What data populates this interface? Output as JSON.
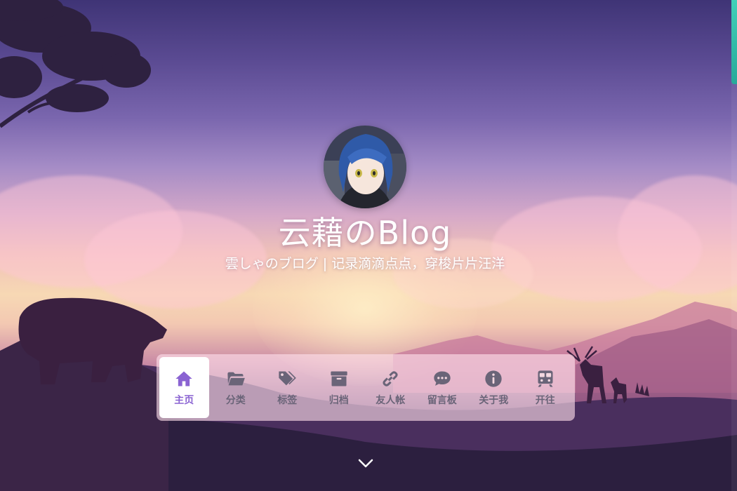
{
  "hero": {
    "title": "云藉のBlog",
    "subtitle": "雲しゃのブログ | 记录滴滴点点，穿梭片片汪洋"
  },
  "nav": {
    "items": [
      {
        "label": "主页",
        "icon": "home-icon",
        "active": true
      },
      {
        "label": "分类",
        "icon": "folder-open-icon",
        "active": false
      },
      {
        "label": "标签",
        "icon": "tags-icon",
        "active": false
      },
      {
        "label": "归档",
        "icon": "archive-icon",
        "active": false
      },
      {
        "label": "友人帐",
        "icon": "link-icon",
        "active": false
      },
      {
        "label": "留言板",
        "icon": "comment-dots-icon",
        "active": false
      },
      {
        "label": "关于我",
        "icon": "info-circle-icon",
        "active": false
      },
      {
        "label": "开往",
        "icon": "train-icon",
        "active": false
      }
    ]
  },
  "colors": {
    "accent": "#8a63d2",
    "nav_text": "#6a6478",
    "scrollbar": "#3fd0b8"
  },
  "scroll_down_icon": "chevron-down-icon"
}
